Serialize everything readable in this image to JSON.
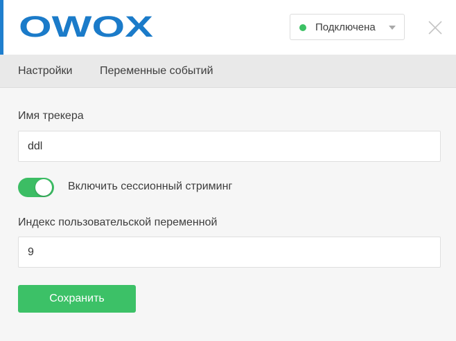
{
  "header": {
    "logo_text": "OWOX",
    "logo_color": "#1b7bc9",
    "accent_color": "#1f7fce",
    "status": {
      "label": "Подключена",
      "color": "#3cc164"
    },
    "close_icon": "close-icon"
  },
  "tabs": [
    {
      "label": "Настройки"
    },
    {
      "label": "Переменные событий"
    }
  ],
  "form": {
    "tracker_name": {
      "label": "Имя трекера",
      "value": "ddl"
    },
    "session_streaming": {
      "label": "Включить сессионный стриминг",
      "enabled": true,
      "color": "#3cbd64"
    },
    "custom_variable_index": {
      "label": "Индекс пользовательской переменной",
      "value": "9"
    },
    "save_label": "Сохранить",
    "save_color": "#3cc167"
  }
}
